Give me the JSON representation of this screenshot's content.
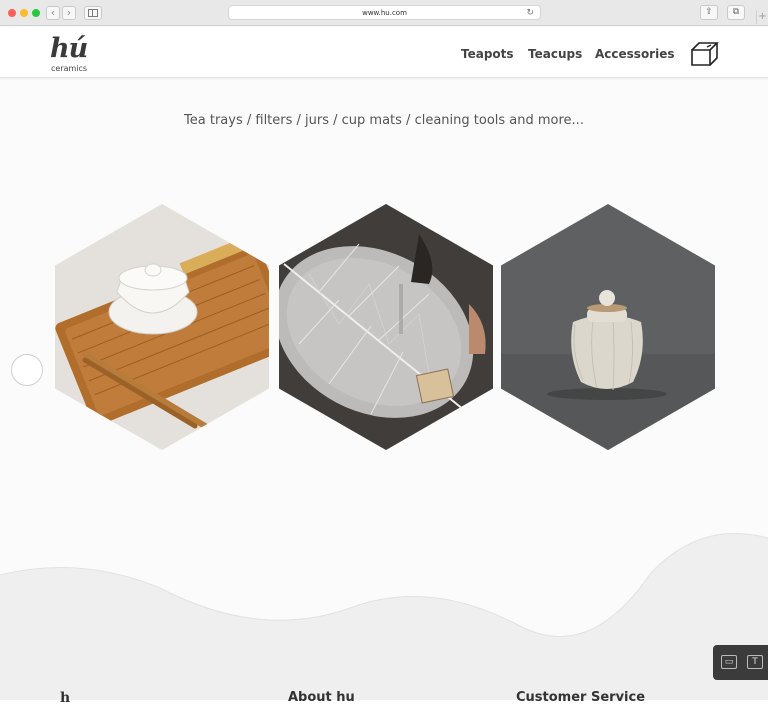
{
  "browser": {
    "url": "www.hu.com",
    "back_icon": "‹",
    "forward_icon": "›",
    "reload_icon": "↻",
    "share_icon": "⇪",
    "tabs_icon": "⧉",
    "newtab_icon": "+"
  },
  "header": {
    "logo_mark": "hú",
    "logo_sub": "ceramics",
    "menu": [
      "Teapots",
      "Teacups",
      "Accessories"
    ],
    "cart_icon": "box-icon"
  },
  "main": {
    "tagline": "Tea trays / filters / jurs / cup mats / cleaning tools and more...",
    "products": [
      {
        "name": "tea-tray-gaiwan-image"
      },
      {
        "name": "leaf-tea-filter-image"
      },
      {
        "name": "ceramic-jar-image"
      }
    ]
  },
  "footer": {
    "logo_partial": "h",
    "about": "About hu",
    "service": "Customer Service"
  },
  "devtools": {
    "b1": "▭",
    "b2": "T"
  },
  "colors": {
    "accent": "#444444",
    "background": "#fbfbfb"
  }
}
